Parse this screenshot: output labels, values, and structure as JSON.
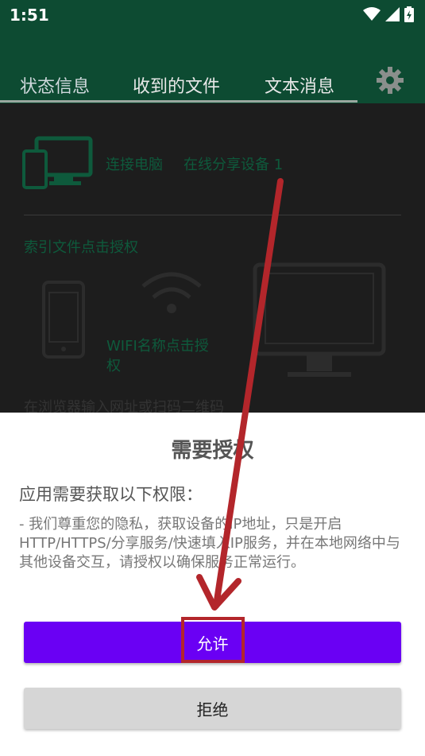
{
  "status_bar": {
    "time": "1:51"
  },
  "tabs": [
    {
      "label": "状态信息"
    },
    {
      "label": "收到的文件"
    },
    {
      "label": "文本消息"
    }
  ],
  "content": {
    "connect_pc": "连接电脑",
    "online_devices": "在线分享设备 1",
    "index_auth": "索引文件点击授权",
    "wifi_name_line1": "WIFI名称点击授",
    "wifi_name_line2": "权",
    "browser_hint": "在浏览器输入网址或扫码二维码"
  },
  "dialog": {
    "title": "需要授权",
    "subtitle": "应用需要获取以下权限：",
    "body": "- 我们尊重您的隐私，获取设备的IP地址，只是开启HTTP/HTTPS/分享服务/快速填入IP服务，并在本地网络中与其他设备交互，请授权以确保服务正常运行。",
    "allow_label": "允许",
    "deny_label": "拒绝"
  },
  "colors": {
    "appbar": "#0d4b32",
    "accent_green": "#0e5a3c",
    "allow_button": "#6a00f4",
    "annotation_red": "#b3262b"
  },
  "icons": [
    "wifi-icon",
    "cellular-icon",
    "battery-icon",
    "gear-icon",
    "devices-icon",
    "phone-icon",
    "monitor-icon"
  ]
}
